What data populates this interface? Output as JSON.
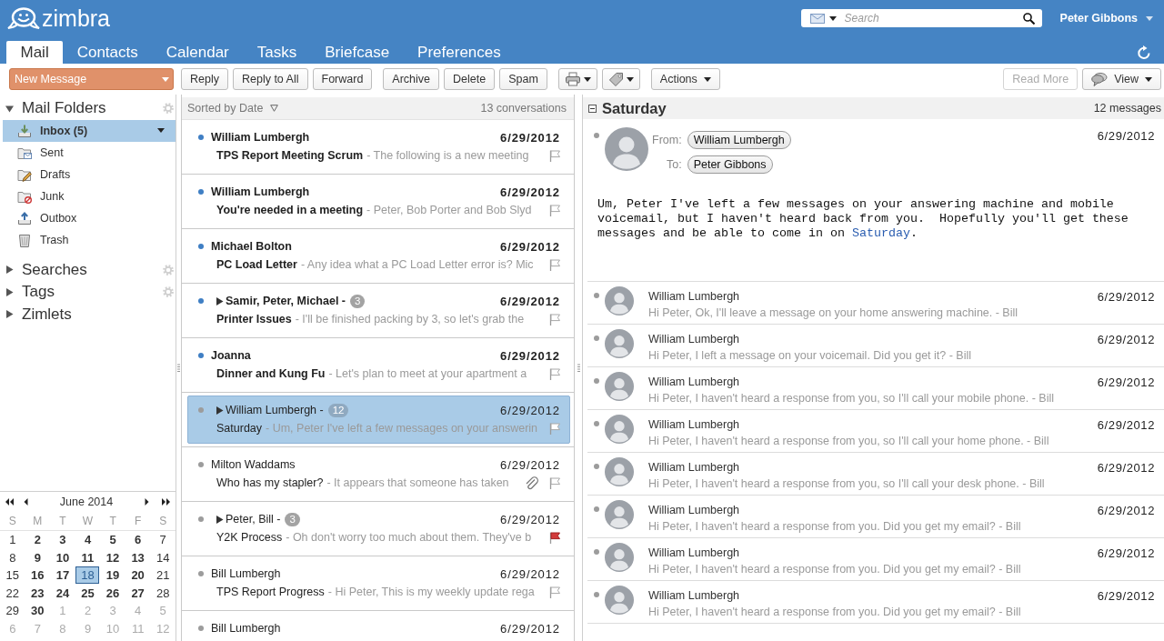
{
  "header": {
    "logo": "zimbra",
    "search": {
      "placeholder": "Search"
    },
    "user": "Peter Gibbons"
  },
  "tabs": [
    {
      "label": "Mail",
      "selected": true
    },
    {
      "label": "Contacts",
      "selected": false
    },
    {
      "label": "Calendar",
      "selected": false
    },
    {
      "label": "Tasks",
      "selected": false
    },
    {
      "label": "Briefcase",
      "selected": false
    },
    {
      "label": "Preferences",
      "selected": false
    }
  ],
  "toolbar": {
    "left": [
      [
        {
          "kind": "compose",
          "label": "New Message",
          "menu": true,
          "disabled": false
        }
      ],
      [
        {
          "kind": "text",
          "label": "Reply",
          "menu": false,
          "disabled": false
        },
        {
          "kind": "text",
          "label": "Reply to All",
          "menu": false,
          "disabled": false
        },
        {
          "kind": "text",
          "label": "Forward",
          "menu": false,
          "disabled": false
        }
      ],
      [
        {
          "kind": "text",
          "label": "Archive",
          "menu": false,
          "disabled": false
        },
        {
          "kind": "text",
          "label": "Delete",
          "menu": false,
          "disabled": false
        },
        {
          "kind": "text",
          "label": "Spam",
          "menu": false,
          "disabled": false
        }
      ],
      [
        {
          "kind": "print",
          "menu": true,
          "disabled": false
        },
        {
          "kind": "tag",
          "menu": true,
          "disabled": false
        }
      ],
      [
        {
          "kind": "text",
          "label": "Actions",
          "menu": true,
          "disabled": false
        }
      ]
    ],
    "right": [
      [
        {
          "kind": "text",
          "label": "Read More",
          "menu": false,
          "disabled": true
        },
        {
          "kind": "view",
          "label": "View",
          "menu": true,
          "disabled": false
        }
      ]
    ]
  },
  "sidebar": {
    "sections": [
      {
        "label": "Mail Folders",
        "expanded": true,
        "settings": true,
        "folders": [
          {
            "kind": "inbox",
            "label": "Inbox (5)",
            "unread": true,
            "selected": true
          },
          {
            "kind": "sent",
            "label": "Sent",
            "unread": false,
            "selected": false
          },
          {
            "kind": "drafts",
            "label": "Drafts",
            "unread": false,
            "selected": false
          },
          {
            "kind": "junk",
            "label": "Junk",
            "unread": false,
            "selected": false
          },
          {
            "kind": "outbox",
            "label": "Outbox",
            "unread": false,
            "selected": false
          },
          {
            "kind": "trash",
            "label": "Trash",
            "unread": false,
            "selected": false
          }
        ]
      },
      {
        "label": "Searches",
        "expanded": false,
        "settings": true
      },
      {
        "label": "Tags",
        "expanded": false,
        "settings": true
      },
      {
        "label": "Zimlets",
        "expanded": false,
        "settings": false
      }
    ]
  },
  "mini_calendar": {
    "title": "June 2014",
    "weekdays": [
      "S",
      "M",
      "T",
      "W",
      "T",
      "F",
      "S"
    ],
    "weeks": [
      [
        {
          "label": "1",
          "kind": "weekend",
          "selected": false
        },
        {
          "label": "2",
          "kind": "weekday",
          "selected": false
        },
        {
          "label": "3",
          "kind": "weekday",
          "selected": false
        },
        {
          "label": "4",
          "kind": "weekday",
          "selected": false
        },
        {
          "label": "5",
          "kind": "weekday",
          "selected": false
        },
        {
          "label": "6",
          "kind": "weekday",
          "selected": false
        },
        {
          "label": "7",
          "kind": "weekend",
          "selected": false
        }
      ],
      [
        {
          "label": "8",
          "kind": "weekend",
          "selected": false
        },
        {
          "label": "9",
          "kind": "weekday",
          "selected": false
        },
        {
          "label": "10",
          "kind": "weekday",
          "selected": false
        },
        {
          "label": "11",
          "kind": "weekday",
          "selected": false
        },
        {
          "label": "12",
          "kind": "weekday",
          "selected": false
        },
        {
          "label": "13",
          "kind": "weekday",
          "selected": false
        },
        {
          "label": "14",
          "kind": "weekend",
          "selected": false
        }
      ],
      [
        {
          "label": "15",
          "kind": "weekend",
          "selected": false
        },
        {
          "label": "16",
          "kind": "weekday",
          "selected": false
        },
        {
          "label": "17",
          "kind": "weekday",
          "selected": false
        },
        {
          "label": "18",
          "kind": "weekday",
          "selected": true
        },
        {
          "label": "19",
          "kind": "weekday",
          "selected": false
        },
        {
          "label": "20",
          "kind": "weekday",
          "selected": false
        },
        {
          "label": "21",
          "kind": "weekend",
          "selected": false
        }
      ],
      [
        {
          "label": "22",
          "kind": "weekend",
          "selected": false
        },
        {
          "label": "23",
          "kind": "weekday",
          "selected": false
        },
        {
          "label": "24",
          "kind": "weekday",
          "selected": false
        },
        {
          "label": "25",
          "kind": "weekday",
          "selected": false
        },
        {
          "label": "26",
          "kind": "weekday",
          "selected": false
        },
        {
          "label": "27",
          "kind": "weekday",
          "selected": false
        },
        {
          "label": "28",
          "kind": "weekend",
          "selected": false
        }
      ],
      [
        {
          "label": "29",
          "kind": "weekend",
          "selected": false
        },
        {
          "label": "30",
          "kind": "weekday",
          "selected": false
        },
        {
          "label": "1",
          "kind": "other_month",
          "selected": false
        },
        {
          "label": "2",
          "kind": "other_month",
          "selected": false
        },
        {
          "label": "3",
          "kind": "other_month",
          "selected": false
        },
        {
          "label": "4",
          "kind": "other_month",
          "selected": false
        },
        {
          "label": "5",
          "kind": "other_month",
          "selected": false
        }
      ],
      [
        {
          "label": "6",
          "kind": "other_month",
          "selected": false
        },
        {
          "label": "7",
          "kind": "other_month",
          "selected": false
        },
        {
          "label": "8",
          "kind": "other_month",
          "selected": false
        },
        {
          "label": "9",
          "kind": "other_month",
          "selected": false
        },
        {
          "label": "10",
          "kind": "other_month",
          "selected": false
        },
        {
          "label": "11",
          "kind": "other_month",
          "selected": false
        },
        {
          "label": "12",
          "kind": "other_month",
          "selected": false
        }
      ]
    ]
  },
  "mail_list": {
    "sort_label": "Sorted by Date",
    "count": "13 conversations",
    "rows": [
      {
        "kind": "message",
        "sender": "William Lumbergh",
        "date": "6/29/2012",
        "subject": "TPS Report Meeting Scrum",
        "preview": "- The following is a new meeting",
        "unread": true,
        "flagged": false,
        "attachment": false,
        "selected": false
      },
      {
        "kind": "message",
        "sender": "William Lumbergh",
        "date": "6/29/2012",
        "subject": "You're needed in a meeting",
        "preview": "- Peter, Bob Porter and Bob Slyd",
        "unread": true,
        "flagged": false,
        "attachment": false,
        "selected": false
      },
      {
        "kind": "message",
        "sender": "Michael Bolton",
        "date": "6/29/2012",
        "subject": "PC Load Letter",
        "preview": "- Any idea what a PC Load Letter error is? Mic",
        "unread": true,
        "flagged": false,
        "attachment": false,
        "selected": false
      },
      {
        "kind": "conversation",
        "expanded": false,
        "sender": "Samir, Peter, Michael -",
        "count": "3",
        "date": "6/29/2012",
        "subject": "Printer Issues",
        "preview": "- I'll be finished packing by 3, so let's grab the",
        "unread": true,
        "flagged": false,
        "attachment": false,
        "selected": false
      },
      {
        "kind": "message",
        "sender": "Joanna",
        "date": "6/29/2012",
        "subject": "Dinner and Kung Fu",
        "preview": "- Let's plan to meet at your apartment a",
        "unread": true,
        "flagged": false,
        "attachment": false,
        "selected": false
      },
      {
        "kind": "conversation",
        "expanded": false,
        "sender": "William Lumbergh -",
        "count": "12",
        "date": "6/29/2012",
        "subject": "Saturday",
        "preview": "- Um, Peter I've left a few messages on your answerin",
        "unread": false,
        "flagged": false,
        "attachment": false,
        "selected": true
      },
      {
        "kind": "message",
        "sender": "Milton Waddams",
        "date": "6/29/2012",
        "subject": "Who has my stapler?",
        "preview": "- It appears that someone has taken",
        "unread": false,
        "flagged": false,
        "attachment": true,
        "selected": false
      },
      {
        "kind": "conversation",
        "expanded": false,
        "sender": "Peter, Bill -",
        "count": "3",
        "date": "6/29/2012",
        "subject": "Y2K Process",
        "preview": "- Oh don't worry too much about them. They've b",
        "unread": false,
        "flagged": true,
        "attachment": false,
        "selected": false
      },
      {
        "kind": "message",
        "sender": "Bill Lumbergh",
        "date": "6/29/2012",
        "subject": "TPS Report Progress",
        "preview": "- Hi Peter, This is my weekly update rega",
        "unread": false,
        "flagged": false,
        "attachment": false,
        "selected": false
      },
      {
        "kind": "message",
        "sender": "Bill Lumbergh",
        "date": "6/29/2012",
        "unread": false,
        "selected": false
      }
    ]
  },
  "reading_pane": {
    "title": "Saturday",
    "count": "12 messages",
    "message": {
      "unread": false,
      "from_label": "From:",
      "from": "William Lumbergh",
      "to_label": "To:",
      "to": "Peter Gibbons",
      "date": "6/29/2012",
      "body": "Um, Peter I've left a few messages on your answering machine and mobile\nvoicemail, but I haven't heard back from you.  Hopefully you'll get these\nmessages and be able to come in on ",
      "link": "Saturday",
      "body_end": "."
    },
    "messages": [
      {
        "sender": "William Lumbergh",
        "date": "6/29/2012",
        "preview": "Hi Peter, Ok, I'll leave a message on your home answering machine. - Bill",
        "unread": false
      },
      {
        "sender": "William Lumbergh",
        "date": "6/29/2012",
        "preview": "Hi Peter, I left a message on your voicemail. Did you get it? - Bill",
        "unread": false
      },
      {
        "sender": "William Lumbergh",
        "date": "6/29/2012",
        "preview": "Hi Peter, I haven't heard a response from you, so I'll call your mobile phone. - Bill",
        "unread": false
      },
      {
        "sender": "William Lumbergh",
        "date": "6/29/2012",
        "preview": "Hi Peter, I haven't heard a response from you, so I'll call your home phone. - Bill",
        "unread": false
      },
      {
        "sender": "William Lumbergh",
        "date": "6/29/2012",
        "preview": "Hi Peter, I haven't heard a response from you, so I'll call your desk phone. - Bill",
        "unread": false
      },
      {
        "sender": "William Lumbergh",
        "date": "6/29/2012",
        "preview": "Hi Peter, I haven't heard a response from you. Did you get my email? - Bill",
        "unread": false
      },
      {
        "sender": "William Lumbergh",
        "date": "6/29/2012",
        "preview": "Hi Peter, I haven't heard a response from you. Did you get my email? - Bill",
        "unread": false
      },
      {
        "sender": "William Lumbergh",
        "date": "6/29/2012",
        "preview": "Hi Peter, I haven't heard a response from you. Did you get my email? - Bill",
        "unread": false
      }
    ]
  }
}
